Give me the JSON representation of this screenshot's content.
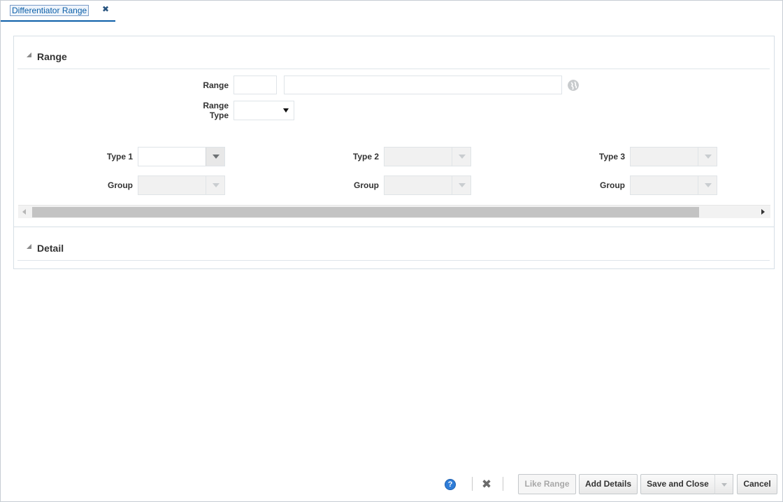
{
  "tab": {
    "label": "Differentiator Range",
    "close_glyph": "✖"
  },
  "range_section": {
    "title": "Range",
    "range_label": "Range",
    "range_code_value": "",
    "range_desc_value": "",
    "range_type_label_line1": "Range",
    "range_type_label_line2": "Type",
    "range_type_value": "",
    "types": [
      {
        "type_label": "Type 1",
        "group_label": "Group",
        "type_value": "",
        "group_value": ""
      },
      {
        "type_label": "Type 2",
        "group_label": "Group",
        "type_value": "",
        "group_value": ""
      },
      {
        "type_label": "Type 3",
        "group_label": "Group",
        "type_value": "",
        "group_value": ""
      }
    ]
  },
  "detail_section": {
    "title": "Detail"
  },
  "footer": {
    "help_glyph": "?",
    "delete_glyph": "✖",
    "like_range_label": "Like Range",
    "add_details_label": "Add Details",
    "save_close_label": "Save and Close",
    "cancel_label": "Cancel"
  },
  "colors": {
    "accent": "#0b5ea8",
    "help": "#2f7dd8"
  },
  "icons": {
    "globe": "globe-icon",
    "help": "help-icon",
    "delete": "delete-icon"
  }
}
